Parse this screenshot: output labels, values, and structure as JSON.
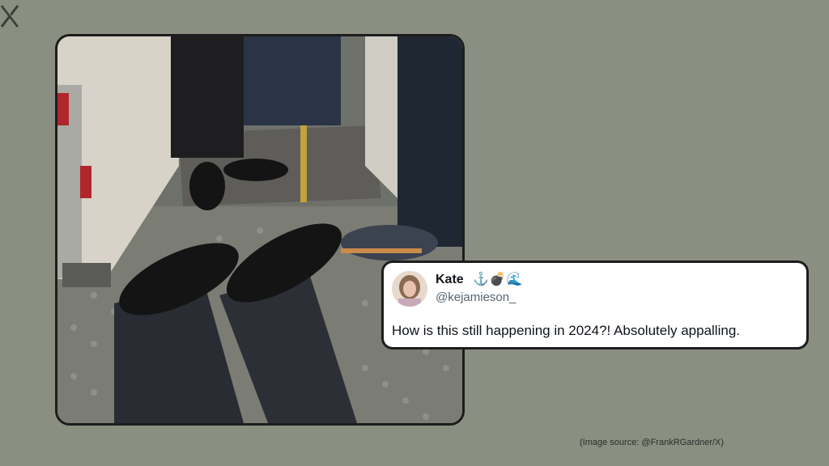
{
  "brand": {
    "logo_icon": "x-logo-icon"
  },
  "photo": {
    "icon": "cabin-floor-photo"
  },
  "tweet": {
    "author_name": "Kate",
    "author_emoji": "⚓💣🌊",
    "author_handle": "@kejamieson_",
    "text": "How is this still happening in 2024?! Absolutely appalling.",
    "avatar_icon": "avatar-icon"
  },
  "caption": {
    "source": "(Image source: @FrankRGardner/X)"
  },
  "colors": {
    "background": "#8a8f82",
    "card": "#ffffff",
    "border": "#1d1d1d",
    "handle": "#536471"
  }
}
